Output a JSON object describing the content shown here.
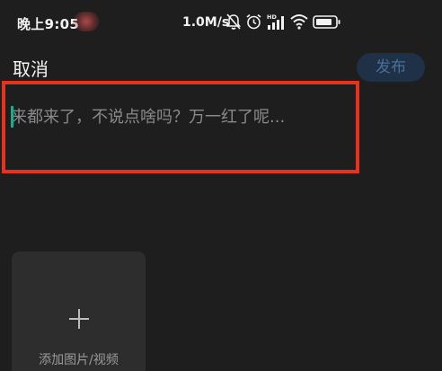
{
  "status_bar": {
    "time": "晚上9:05",
    "net_speed": "1.0M/s",
    "icons": [
      "bell-muted-icon",
      "alarm-icon",
      "hd-signal-icon",
      "wifi-icon",
      "battery-icon"
    ]
  },
  "header": {
    "cancel_label": "取消",
    "publish_label": "发布"
  },
  "composer": {
    "placeholder": "来都来了，不说点啥吗？万一红了呢..."
  },
  "media": {
    "add_label": "添加图片/视频"
  },
  "colors": {
    "background": "#1e1e1e",
    "highlight": "#e8321b",
    "caret": "#2aa58a",
    "publish_bg": "#1f3147",
    "publish_text": "#4a6f97"
  }
}
